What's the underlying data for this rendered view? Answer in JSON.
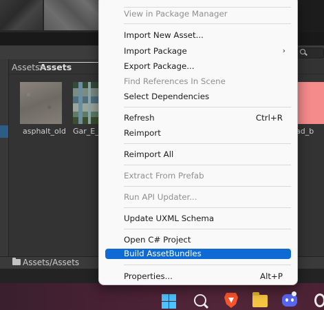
{
  "project": {
    "breadcrumb": [
      "Assets",
      "Assets"
    ],
    "breadcrumb_separator": ">",
    "assets": [
      {
        "name": "asphalt_old"
      },
      {
        "name": "Gar_E_d"
      },
      {
        "name": "ad_b"
      }
    ],
    "footer_path": "Assets/Assets"
  },
  "context_menu": {
    "items": [
      {
        "label": "View in Package Manager",
        "enabled": false
      },
      {
        "label": "Import New Asset...",
        "enabled": true
      },
      {
        "label": "Import Package",
        "enabled": true,
        "submenu": true
      },
      {
        "label": "Export Package...",
        "enabled": true
      },
      {
        "label": "Find References In Scene",
        "enabled": false
      },
      {
        "label": "Select Dependencies",
        "enabled": true
      },
      {
        "label": "Refresh",
        "shortcut": "Ctrl+R",
        "enabled": true
      },
      {
        "label": "Reimport",
        "enabled": true
      },
      {
        "label": "Reimport All",
        "enabled": true
      },
      {
        "label": "Extract From Prefab",
        "enabled": false
      },
      {
        "label": "Run API Updater...",
        "enabled": false
      },
      {
        "label": "Update UXML Schema",
        "enabled": true
      },
      {
        "label": "Open C# Project",
        "enabled": true
      },
      {
        "label": "Build AssetBundles",
        "enabled": true,
        "highlighted": true
      },
      {
        "label": "Properties...",
        "shortcut": "Alt+P",
        "enabled": true
      }
    ],
    "submenu_arrow": "›",
    "highlight_color": "#0f6bd3"
  },
  "taskbar": {
    "icons": [
      "windows-start-icon",
      "search-icon",
      "brave-browser-icon",
      "file-explorer-icon",
      "discord-icon",
      "app-icon"
    ]
  }
}
